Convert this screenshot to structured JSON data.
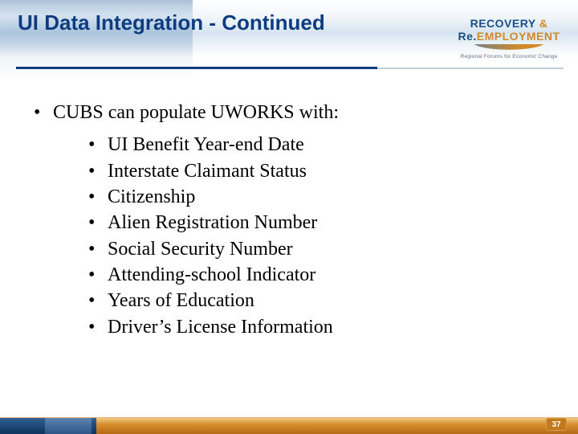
{
  "header": {
    "title": "UI Data Integration - Continued",
    "logo": {
      "line1_a": "RECOVERY",
      "line1_amp": " & ",
      "line2_prefix": "Re.",
      "line2_main": "EMPLOYMENT",
      "tagline": "Regional Forums for Economic Change"
    }
  },
  "body": {
    "lead": "CUBS can populate UWORKS with:",
    "items": [
      "UI Benefit Year-end Date",
      "Interstate Claimant Status",
      "Citizenship",
      "Alien Registration Number",
      "Social Security Number",
      "Attending-school Indicator",
      "Years of Education",
      "Driver’s License Information"
    ]
  },
  "footer": {
    "page_number": "37"
  }
}
